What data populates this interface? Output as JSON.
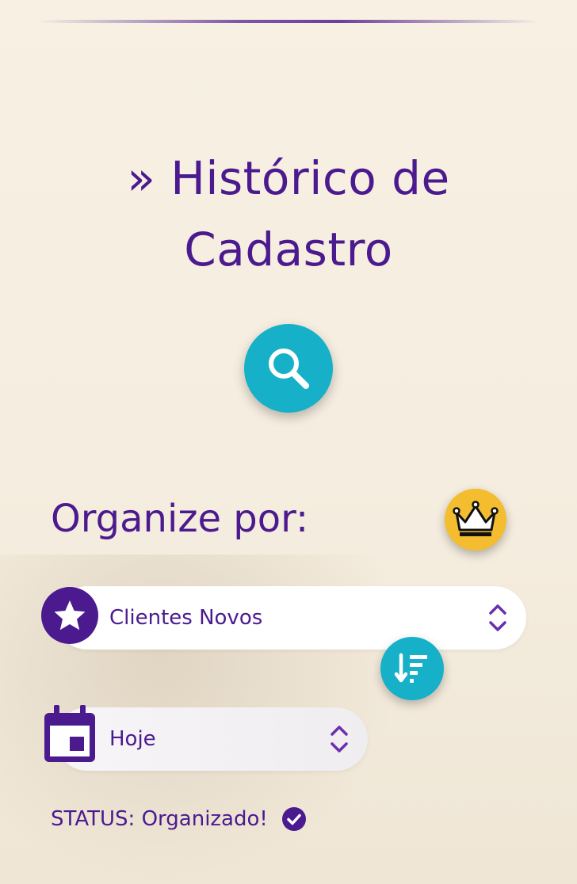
{
  "header": {
    "title_line1": "» Histórico de",
    "title_line2": "Cadastro"
  },
  "actions": {
    "search_icon": "search-icon",
    "premium_icon": "crown-icon",
    "sort_icon": "sort-descending-icon"
  },
  "organize": {
    "label": "Organize por:",
    "category_select": {
      "value": "Clientes Novos",
      "icon": "star-icon"
    },
    "period_select": {
      "value": "Hoje",
      "icon": "calendar-icon"
    }
  },
  "status": {
    "text": "STATUS: Organizado!",
    "icon": "check-circle-icon"
  },
  "colors": {
    "primary": "#4b1a8f",
    "accent": "#16b0c8",
    "gold": "#f3bd2f",
    "background": "#f6efe2"
  }
}
